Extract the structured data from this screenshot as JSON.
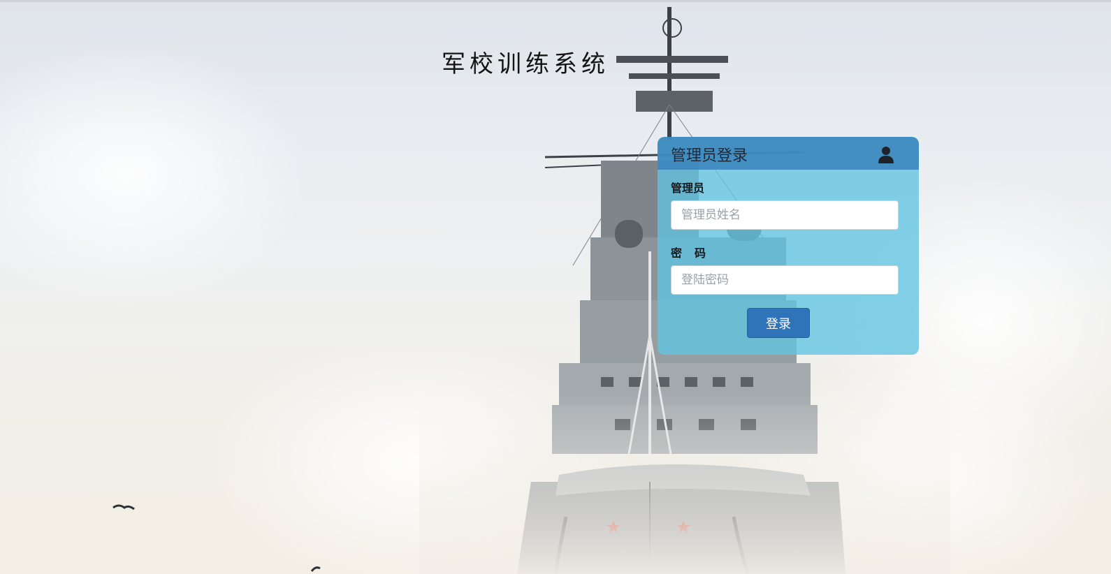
{
  "page": {
    "title": "军校训练系统",
    "background_image": "warship-bow-in-mist"
  },
  "login": {
    "header_title": "管理员登录",
    "header_icon": "user-icon",
    "username_label": "管理员",
    "username_placeholder": "管理员姓名",
    "username_value": "",
    "password_label": "密码",
    "password_placeholder": "登陆密码",
    "password_value": "",
    "submit_label": "登录"
  },
  "colors": {
    "panel_bg": "#60c4e2",
    "panel_header": "#3884bc",
    "button": "#2f74b8",
    "title_text": "#141414"
  }
}
